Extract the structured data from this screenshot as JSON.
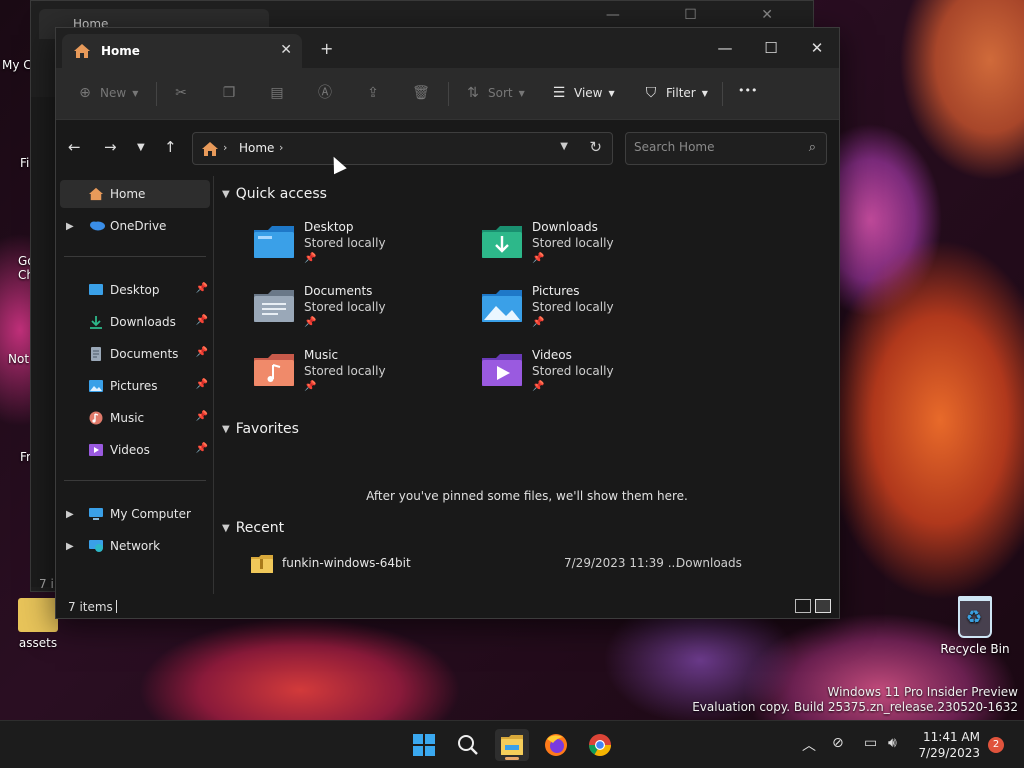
{
  "desktop": {
    "left_labels": [
      "My C",
      "Fi",
      "Go",
      "Ch",
      "Not",
      "Fr"
    ],
    "assets_label": "assets",
    "recycle_label": "Recycle Bin",
    "watermark_line1": "Windows 11 Pro Insider Preview",
    "watermark_line2": "Evaluation copy. Build 25375.zn_release.230520-1632"
  },
  "bg_window": {
    "tab_title": "Home",
    "side_labels": [
      "7 i"
    ]
  },
  "window": {
    "tab_title": "Home",
    "tab_close": "✕",
    "new_tab": "+",
    "caption_min": "—",
    "caption_max": "☐",
    "caption_close": "✕"
  },
  "toolbar": {
    "new_label": "New",
    "sort_label": "Sort",
    "view_label": "View",
    "filter_label": "Filter",
    "more_label": "•••"
  },
  "nav": {
    "crumb": "Home",
    "search_placeholder": "Search Home"
  },
  "sidebar": {
    "items": [
      {
        "label": "Home"
      },
      {
        "label": "OneDrive"
      },
      {
        "label": "Desktop"
      },
      {
        "label": "Downloads"
      },
      {
        "label": "Documents"
      },
      {
        "label": "Pictures"
      },
      {
        "label": "Music"
      },
      {
        "label": "Videos"
      },
      {
        "label": "My Computer"
      },
      {
        "label": "Network"
      }
    ]
  },
  "content": {
    "quick_access_title": "Quick access",
    "quick_access": [
      {
        "name": "Desktop",
        "sub": "Stored locally"
      },
      {
        "name": "Downloads",
        "sub": "Stored locally"
      },
      {
        "name": "Documents",
        "sub": "Stored locally"
      },
      {
        "name": "Pictures",
        "sub": "Stored locally"
      },
      {
        "name": "Music",
        "sub": "Stored locally"
      },
      {
        "name": "Videos",
        "sub": "Stored locally"
      }
    ],
    "favorites_title": "Favorites",
    "favorites_message": "After you've pinned some files, we'll show them here.",
    "recent_title": "Recent",
    "recent": [
      {
        "name": "funkin-windows-64bit",
        "date": "7/29/2023 11:39 ...",
        "location": "Downloads"
      }
    ]
  },
  "status": {
    "count": "7 items"
  },
  "taskbar": {
    "time": "11:41 AM",
    "date": "7/29/2023",
    "notifications": "2"
  },
  "colors": {
    "accent": "#e8a66a",
    "folder_blue": "#3aa0e8",
    "folder_green": "#2db88a",
    "notif_red": "#e0533c"
  }
}
